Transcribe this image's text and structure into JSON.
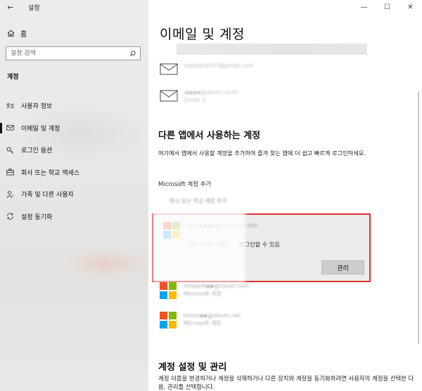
{
  "window": {
    "app_title": "설정",
    "controls": {
      "minimize": "—",
      "maximize": "☐",
      "close": "✕"
    }
  },
  "sidebar": {
    "back_label": "←",
    "home_label": "홈",
    "search_placeholder": "설정 검색",
    "section_label": "계정",
    "items": [
      {
        "label": "사용자 정보",
        "icon": "user-info-icon",
        "active": false
      },
      {
        "label": "이메일 및 계정",
        "icon": "mail-icon",
        "active": true
      },
      {
        "label": "로그인 옵션",
        "icon": "key-icon",
        "active": false
      },
      {
        "label": "회사 또는 학교 액세스",
        "icon": "briefcase-icon",
        "active": false
      },
      {
        "label": "가족 및 다른 사용자",
        "icon": "person-icon",
        "active": false
      },
      {
        "label": "설정 동기화",
        "icon": "sync-icon",
        "active": false
      }
    ]
  },
  "main": {
    "page_title": "이메일 및 계정",
    "email_accounts": [
      {
        "email": "outlook4437@gmail.com",
        "type": ""
      },
      {
        "email": "l▪▪▪▪@daum.co.kr",
        "type": "Gmail 2"
      }
    ],
    "other_apps_heading": "다른 앱에서 사용하는 계정",
    "other_apps_desc": "여기에서 앱에서 사용할 계정을 추가하여 즐겨 찾는 앱에 더 쉽고 빠르게 로그인하세요.",
    "ms_add_label": "Microsoft 계정 추가",
    "ms_add_sub": "회사 또는 학교 계정 추가",
    "selected_account": {
      "email": "wsh1▪▪▪@outlook.com",
      "type": "Microsoft 계정",
      "note": "로그인할 수 있음",
      "manage_button": "관리"
    },
    "other_ms_accounts": [
      {
        "email": "limban6▪▪@naver.com",
        "type": "Microsoft 계정"
      },
      {
        "email": "tolum▪▪@daum.net",
        "type": "Microsoft 계정"
      }
    ],
    "manage_heading": "계정 설정 및 관리",
    "manage_desc": "계정 이름을 변경하거나 계정을 삭제하거나 다른 장치와 계정을 동기화하려면 사용자의 계정을 선택한 다음, 관리를 선택합니다."
  },
  "colors": {
    "selection_border": "#d33333",
    "ms_red": "#f25022",
    "ms_green": "#7fba00",
    "ms_blue": "#00a4ef",
    "ms_yellow": "#ffb900"
  }
}
